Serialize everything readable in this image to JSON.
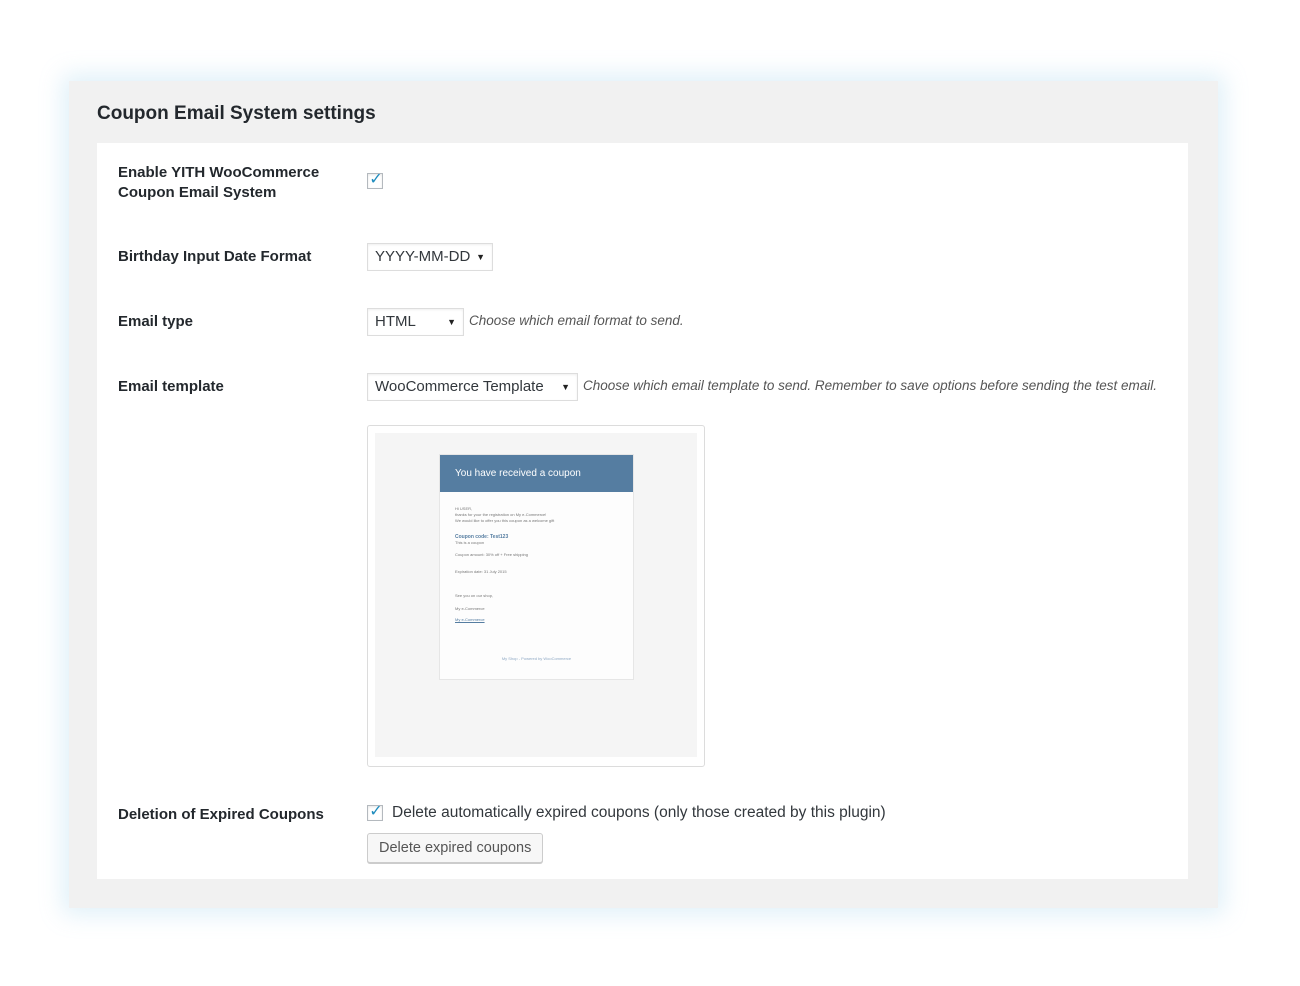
{
  "page": {
    "title": "Coupon Email System settings"
  },
  "settings": {
    "enable": {
      "label_line1": "Enable YITH WooCommerce",
      "label_line2": "Coupon Email System",
      "checked": true
    },
    "birthday_format": {
      "label": "Birthday Input Date Format",
      "value": "YYYY-MM-DD"
    },
    "email_type": {
      "label": "Email type",
      "value": "HTML",
      "description": "Choose which email format to send."
    },
    "email_template": {
      "label": "Email template",
      "value": "WooCommerce Template",
      "description": "Choose which email template to send. Remember to save options before sending the test email."
    },
    "deletion": {
      "label": "Deletion of Expired Coupons",
      "checkbox_label": "Delete automatically expired coupons (only those created by this plugin)",
      "checked": true,
      "button_label": "Delete expired coupons"
    }
  },
  "preview": {
    "header": "You have received a coupon",
    "greeting": "Hi USER,",
    "line1": "thanks for your the registration on My e-Commerce!",
    "line2": "We would like to offer you this coupon as a welcome gift",
    "coupon_code": "Coupon code: Test123",
    "coupon_note": "This is a coupon",
    "coupon_amount": "Coupon amount: 30% off + Free shipping",
    "expiration": "Expiration date: 31 July 2015",
    "see_you": "See you on our shop,",
    "shop_name": "My e-Commerce",
    "shop_link": "My e-Commerce",
    "footer": "My Shop - Powered by WooCommerce"
  },
  "colors": {
    "accent": "#1e8cbe",
    "email_header": "#557da1",
    "panel_bg": "#f1f1f1"
  },
  "icons": {
    "checkbox_check": "checkmark-icon",
    "select_arrow": "caret-down-icon"
  }
}
